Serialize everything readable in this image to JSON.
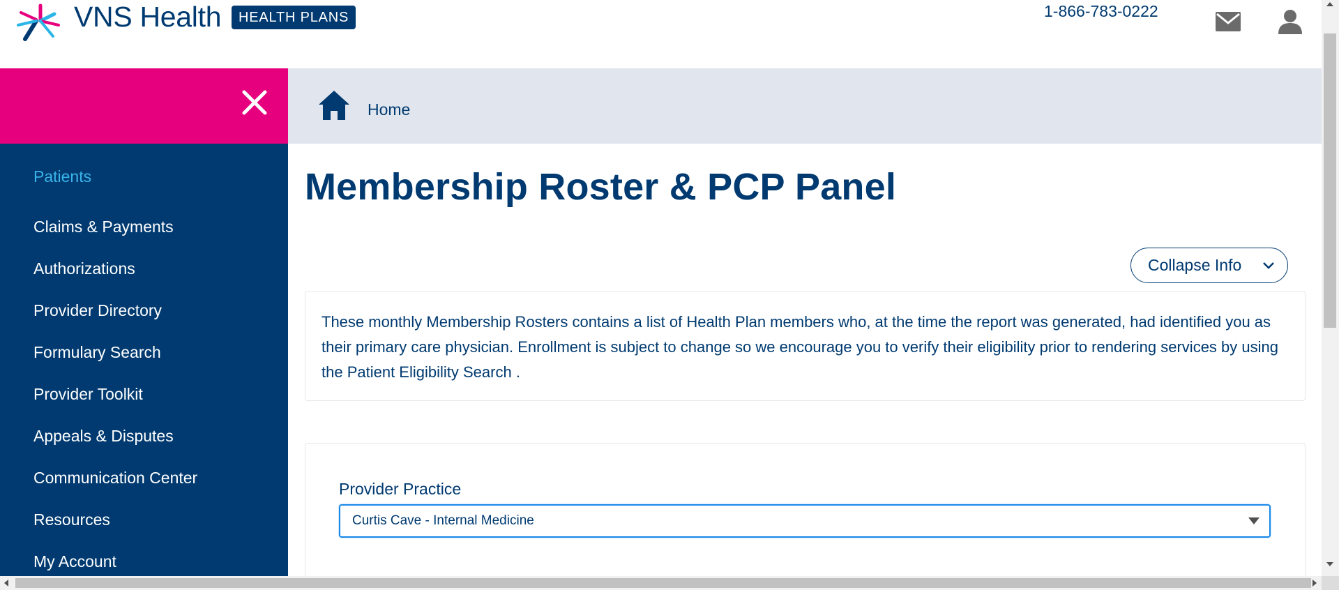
{
  "header": {
    "brand_name": "VNS Health",
    "badge": "HEALTH PLANS",
    "phone": "1-866-783-0222",
    "icons": [
      "logo-burst-icon",
      "mail-icon",
      "user-icon"
    ]
  },
  "sidebar": {
    "close_icon": "close-icon",
    "items": [
      {
        "label": "Patients",
        "active": true
      },
      {
        "label": "Claims & Payments",
        "active": false
      },
      {
        "label": "Authorizations",
        "active": false
      },
      {
        "label": "Provider Directory",
        "active": false
      },
      {
        "label": "Formulary Search",
        "active": false
      },
      {
        "label": "Provider Toolkit",
        "active": false
      },
      {
        "label": "Appeals & Disputes",
        "active": false
      },
      {
        "label": "Communication Center",
        "active": false
      },
      {
        "label": "Resources",
        "active": false
      },
      {
        "label": "My Account",
        "active": false
      }
    ]
  },
  "breadcrumb": {
    "home_icon": "home-icon",
    "home_label": "Home"
  },
  "main": {
    "title": "Membership Roster & PCP Panel",
    "collapse_button": "Collapse Info",
    "info_text": "These monthly Membership Rosters contains a list of Health Plan members who, at the time the report was generated, had identified you as their primary care physician. Enrollment is subject to change so we encourage you to verify their eligibility prior to rendering services by using the Patient Eligibility Search .",
    "provider_practice": {
      "label": "Provider Practice",
      "selected": "Curtis Cave - Internal Medicine"
    }
  },
  "colors": {
    "navy": "#003a70",
    "magenta": "#e6007e",
    "active_link": "#3ab4ea",
    "breadcrumb_bg": "#e1e6ee",
    "focus_border": "#1a8ae8"
  }
}
